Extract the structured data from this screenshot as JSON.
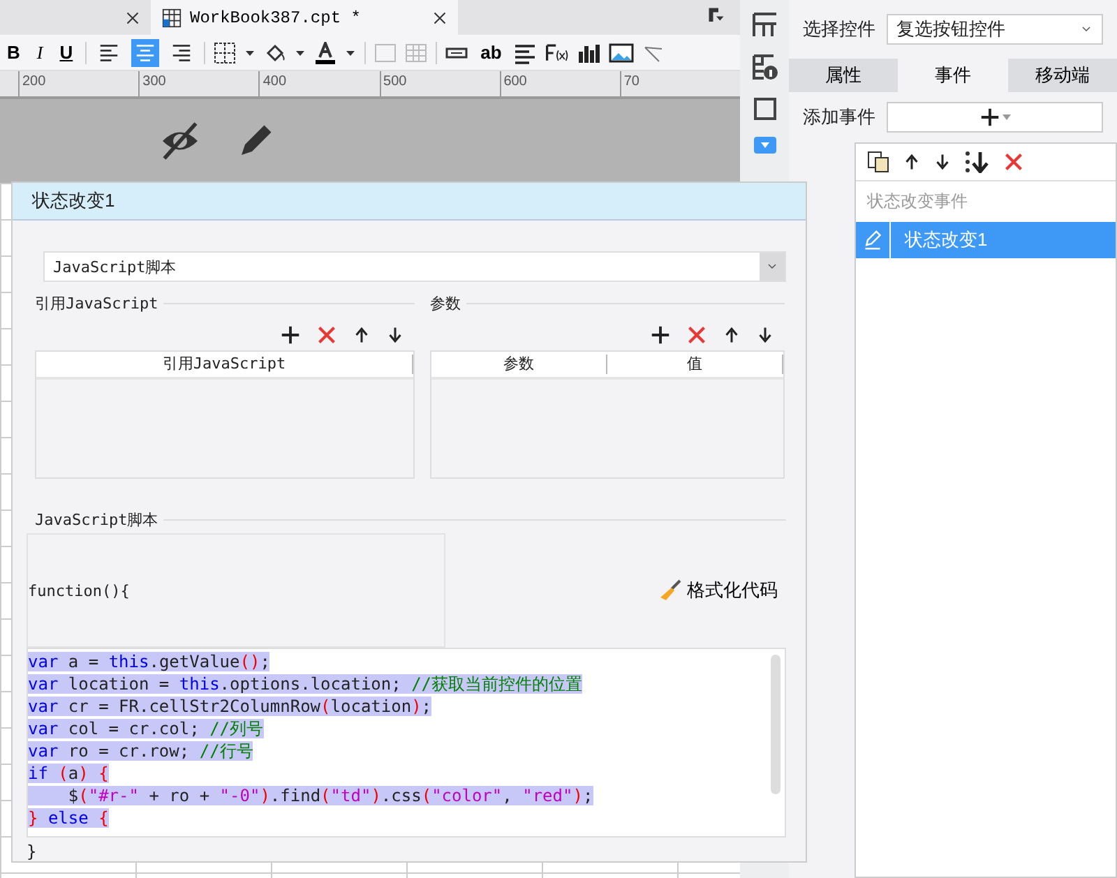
{
  "tabs": [
    {
      "selected": false
    },
    {
      "label": "WorkBook387.cpt *",
      "selected": true
    }
  ],
  "toolbar": {
    "format_buttons": [
      "B",
      "I",
      "U"
    ],
    "align_buttons": [
      {
        "selected": false
      },
      {
        "selected": true
      },
      {
        "selected": false
      }
    ],
    "text_label": "ab"
  },
  "ruler": [
    "200",
    "300",
    "400",
    "500",
    "600",
    "70"
  ],
  "right_panel": {
    "select_label": "选择控件",
    "select_value": "复选按钮控件",
    "tabs": [
      {
        "label": "属性",
        "selected": false
      },
      {
        "label": "事件",
        "selected": true
      },
      {
        "label": "移动端",
        "selected": false
      }
    ],
    "add_event_label": "添加事件",
    "event_group": "状态改变事件",
    "events": [
      {
        "label": "状态改变1",
        "selected": true
      }
    ]
  },
  "dialog": {
    "title": "状态改变1",
    "type_value": "JavaScript脚本",
    "ref_section": "引用JavaScript",
    "ref_columns": [
      "引用JavaScript"
    ],
    "param_section": "参数",
    "param_columns": [
      "参数",
      "值"
    ],
    "script_section": "JavaScript脚本",
    "function_header": "function(){",
    "format_button": "格式化代码",
    "code_lines": [
      [
        {
          "kind": "kw",
          "text": "var"
        },
        {
          "kind": "plain",
          "text": " a = "
        },
        {
          "kind": "kw",
          "text": "this"
        },
        {
          "kind": "plain",
          "text": ".getValue"
        },
        {
          "kind": "paren",
          "text": "()"
        },
        {
          "kind": "plain",
          "text": ";"
        }
      ],
      [
        {
          "kind": "kw",
          "text": "var"
        },
        {
          "kind": "plain",
          "text": " location = "
        },
        {
          "kind": "kw",
          "text": "this"
        },
        {
          "kind": "plain",
          "text": ".options.location; "
        },
        {
          "kind": "comment",
          "text": "//获取当前控件的位置"
        }
      ],
      [
        {
          "kind": "kw",
          "text": "var"
        },
        {
          "kind": "plain",
          "text": " cr = FR.cellStr2ColumnRow"
        },
        {
          "kind": "paren",
          "text": "("
        },
        {
          "kind": "plain",
          "text": "location"
        },
        {
          "kind": "paren",
          "text": ")"
        },
        {
          "kind": "plain",
          "text": ";"
        }
      ],
      [
        {
          "kind": "kw",
          "text": "var"
        },
        {
          "kind": "plain",
          "text": " col = cr.col; "
        },
        {
          "kind": "comment",
          "text": "//列号"
        }
      ],
      [
        {
          "kind": "kw",
          "text": "var"
        },
        {
          "kind": "plain",
          "text": " ro = cr.row; "
        },
        {
          "kind": "comment",
          "text": "//行号"
        }
      ],
      [
        {
          "kind": "kw",
          "text": "if"
        },
        {
          "kind": "paren",
          "text": " ("
        },
        {
          "kind": "plain",
          "text": "a"
        },
        {
          "kind": "paren",
          "text": ") {"
        }
      ],
      [
        {
          "kind": "plain",
          "text": "    $"
        },
        {
          "kind": "paren",
          "text": "("
        },
        {
          "kind": "string",
          "text": "\"#r-\""
        },
        {
          "kind": "plain",
          "text": " + ro + "
        },
        {
          "kind": "string",
          "text": "\"-0\""
        },
        {
          "kind": "paren",
          "text": ")"
        },
        {
          "kind": "plain",
          "text": ".find"
        },
        {
          "kind": "paren",
          "text": "("
        },
        {
          "kind": "string",
          "text": "\"td\""
        },
        {
          "kind": "paren",
          "text": ")"
        },
        {
          "kind": "plain",
          "text": ".css"
        },
        {
          "kind": "paren",
          "text": "("
        },
        {
          "kind": "string",
          "text": "\"color\""
        },
        {
          "kind": "plain",
          "text": ", "
        },
        {
          "kind": "string",
          "text": "\"red\""
        },
        {
          "kind": "paren",
          "text": ")"
        },
        {
          "kind": "plain",
          "text": ";"
        }
      ],
      [
        {
          "kind": "paren",
          "text": "}"
        },
        {
          "kind": "kw",
          "text": " else"
        },
        {
          "kind": "paren",
          "text": " {"
        }
      ]
    ],
    "closing": "}"
  }
}
